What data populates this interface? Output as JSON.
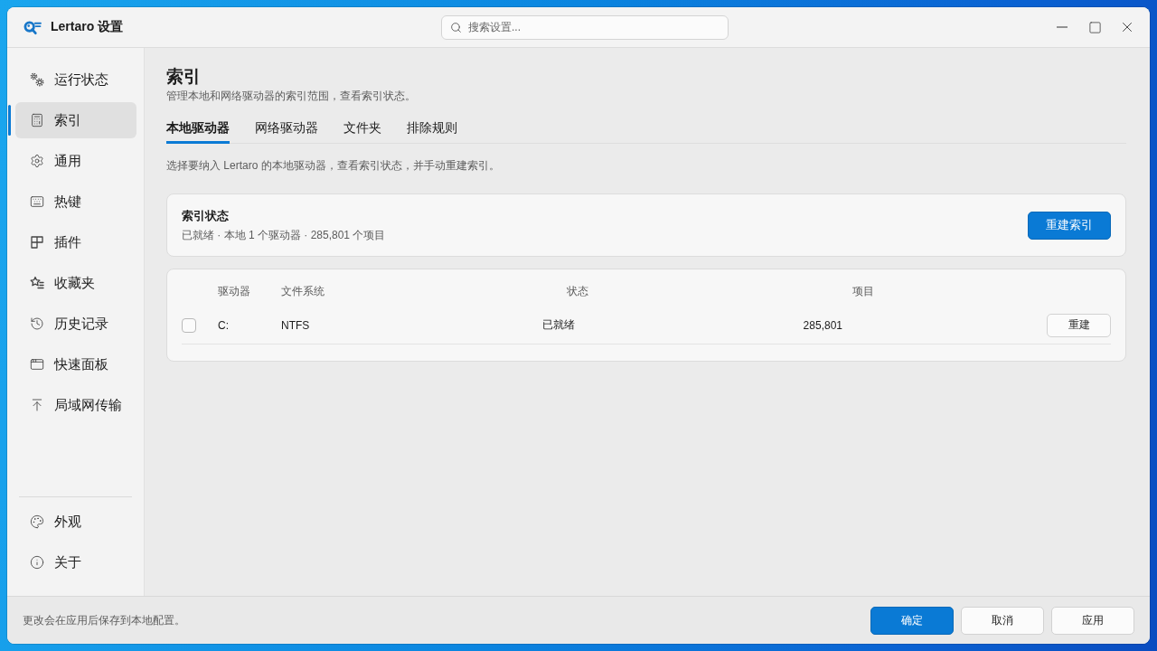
{
  "window": {
    "title": "Lertaro 设置"
  },
  "search": {
    "placeholder": "搜索设置..."
  },
  "sidebar": {
    "items": [
      {
        "label": "运行状态",
        "selected": false
      },
      {
        "label": "索引",
        "selected": true
      },
      {
        "label": "通用",
        "selected": false
      },
      {
        "label": "热键",
        "selected": false
      },
      {
        "label": "插件",
        "selected": false
      },
      {
        "label": "收藏夹",
        "selected": false
      },
      {
        "label": "历史记录",
        "selected": false
      },
      {
        "label": "快速面板",
        "selected": false
      },
      {
        "label": "局域网传输",
        "selected": false
      }
    ],
    "bottom_items": [
      {
        "label": "外观",
        "selected": false
      },
      {
        "label": "关于",
        "selected": false
      }
    ]
  },
  "page": {
    "title": "索引",
    "subtitle": "管理本地和网络驱动器的索引范围，查看索引状态。"
  },
  "tabs": [
    {
      "label": "本地驱动器",
      "selected": true
    },
    {
      "label": "网络驱动器",
      "selected": false
    },
    {
      "label": "文件夹",
      "selected": false
    },
    {
      "label": "排除规则",
      "selected": false
    }
  ],
  "description": "选择要纳入 Lertaro 的本地驱动器，查看索引状态，并手动重建索引。",
  "status_card": {
    "title": "索引状态",
    "summary": "已就绪 · 本地 1 个驱动器 · 285,801 个项目",
    "button": "重建索引"
  },
  "table": {
    "columns": [
      "驱动器",
      "文件系统",
      "状态",
      "项目"
    ],
    "rows": [
      {
        "checked": false,
        "cells": [
          "C:",
          "NTFS",
          "已就绪",
          "285,801"
        ],
        "action": "重建"
      }
    ]
  },
  "footer": {
    "note": "更改会在应用后保存到本地配置。",
    "buttons": [
      {
        "label": "确定",
        "kind": "primary"
      },
      {
        "label": "取消",
        "kind": "secondary"
      },
      {
        "label": "应用",
        "kind": "secondary"
      }
    ]
  }
}
